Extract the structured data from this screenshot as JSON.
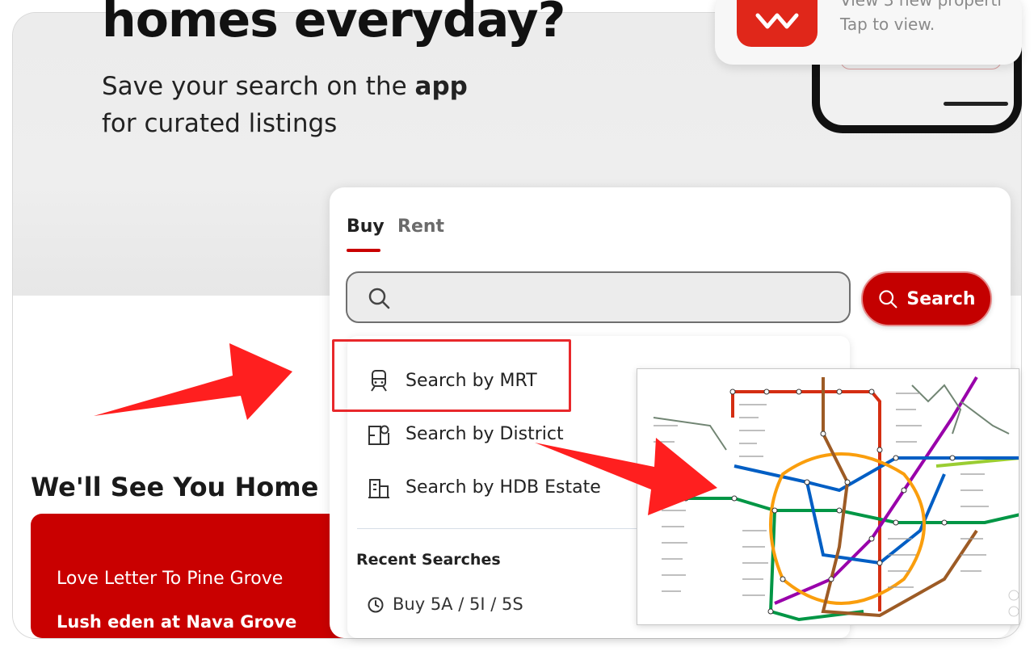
{
  "hero": {
    "title": "homes everyday?",
    "subtitle_line1": "Save your search on the",
    "subtitle_bold": "app",
    "subtitle_line2": "for curated listings"
  },
  "notification": {
    "line1": "View 3 new properti",
    "line2": "Tap to view."
  },
  "tabs": [
    {
      "label": "Buy",
      "active": true
    },
    {
      "label": "Rent",
      "active": false
    }
  ],
  "search": {
    "placeholder": "",
    "value": "",
    "button_label": "Search"
  },
  "dropdown": {
    "options": [
      {
        "label": "Search by MRT",
        "icon": "train-icon"
      },
      {
        "label": "Search by District",
        "icon": "district-icon"
      },
      {
        "label": "Search by HDB Estate",
        "icon": "building-icon"
      }
    ],
    "recent_title": "Recent Searches",
    "recent_items": [
      {
        "label": "Buy 5A / 5I / 5S",
        "icon": "clock-icon"
      }
    ]
  },
  "section": {
    "title": "We'll See You Home"
  },
  "card": {
    "line1": "Love Letter To Pine Grove",
    "line2": "Lush eden at Nava Grove"
  },
  "colors": {
    "accent": "#c40000",
    "highlight": "#e8282b"
  }
}
